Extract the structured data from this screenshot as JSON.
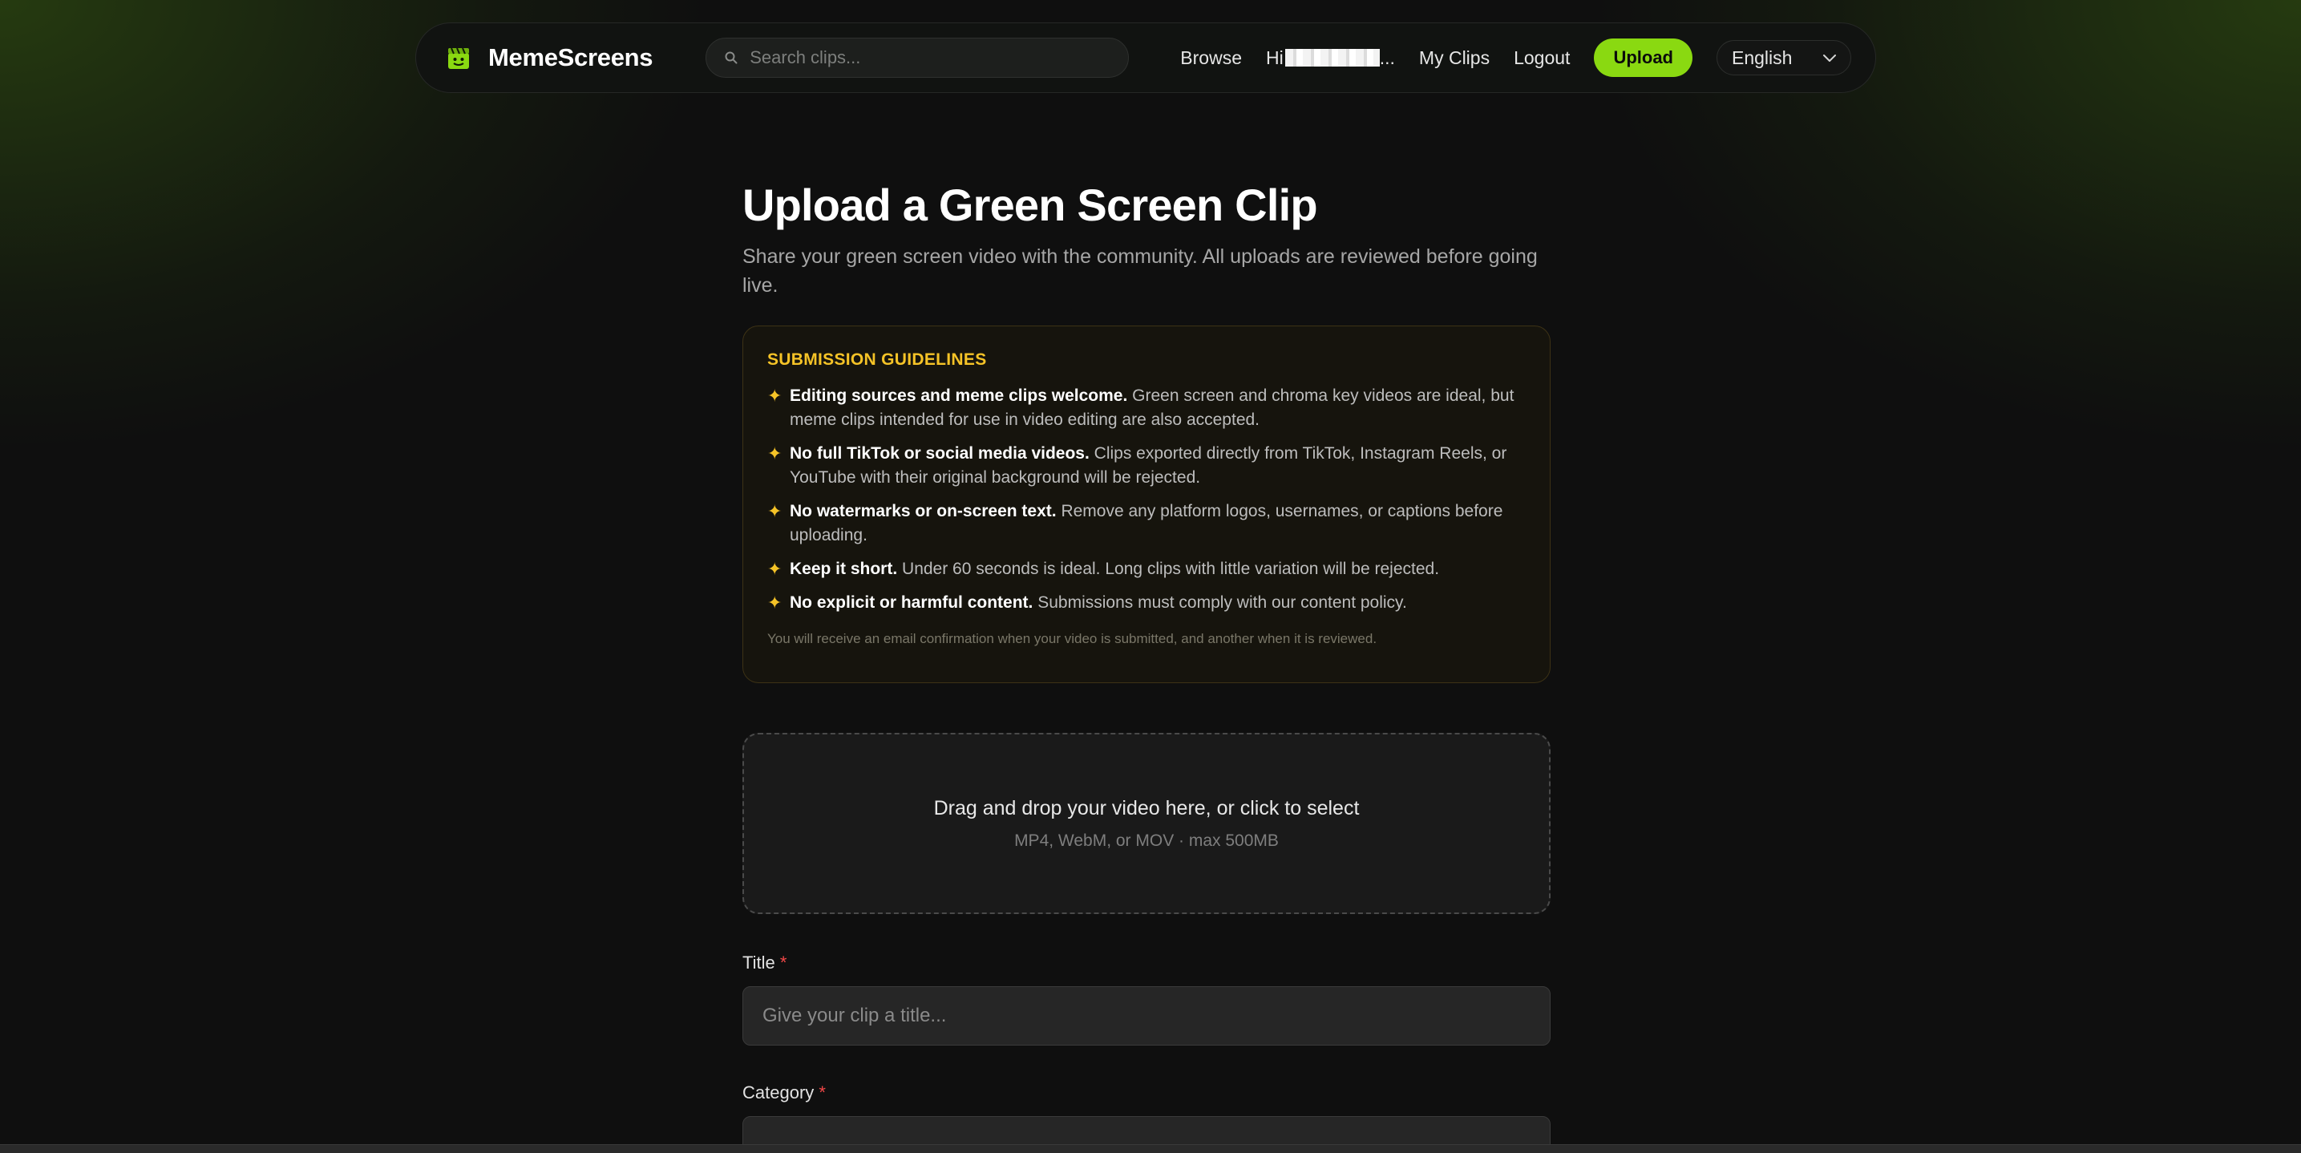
{
  "header": {
    "brand": "MemeScreens",
    "search_placeholder": "Search clips...",
    "nav": {
      "browse": "Browse",
      "user_greeting": "Hi",
      "user_suffix": "...",
      "my_clips": "My Clips",
      "logout": "Logout",
      "upload": "Upload"
    },
    "language": "English"
  },
  "page": {
    "title": "Upload a Green Screen Clip",
    "subtitle": "Share your green screen video with the community. All uploads are reviewed before going live."
  },
  "guidelines": {
    "heading": "SUBMISSION GUIDELINES",
    "items": [
      {
        "bold": "Editing sources and meme clips welcome.",
        "text": " Green screen and chroma key videos are ideal, but meme clips intended for use in video editing are also accepted."
      },
      {
        "bold": "No full TikTok or social media videos.",
        "text": " Clips exported directly from TikTok, Instagram Reels, or YouTube with their original background will be rejected."
      },
      {
        "bold": "No watermarks or on-screen text.",
        "text": " Remove any platform logos, usernames, or captions before uploading."
      },
      {
        "bold": "Keep it short.",
        "text": " Under 60 seconds is ideal. Long clips with little variation will be rejected."
      },
      {
        "bold": "No explicit or harmful content.",
        "text": " Submissions must comply with our content policy."
      }
    ],
    "note": "You will receive an email confirmation when your video is submitted, and another when it is reviewed."
  },
  "dropzone": {
    "main": "Drag and drop your video here, or click to select",
    "sub": "MP4, WebM, or MOV · max 500MB"
  },
  "form": {
    "title_label": "Title",
    "title_placeholder": "Give your clip a title...",
    "category_label": "Category",
    "required_mark": "*"
  },
  "colors": {
    "accent": "#8ad911",
    "guideline_accent": "#f5c327",
    "required": "#f24848"
  },
  "icons": {
    "logo": "clapper-face-icon",
    "search": "search-icon",
    "language": "chevron-down-icon",
    "bullet": "sparkle-icon"
  }
}
